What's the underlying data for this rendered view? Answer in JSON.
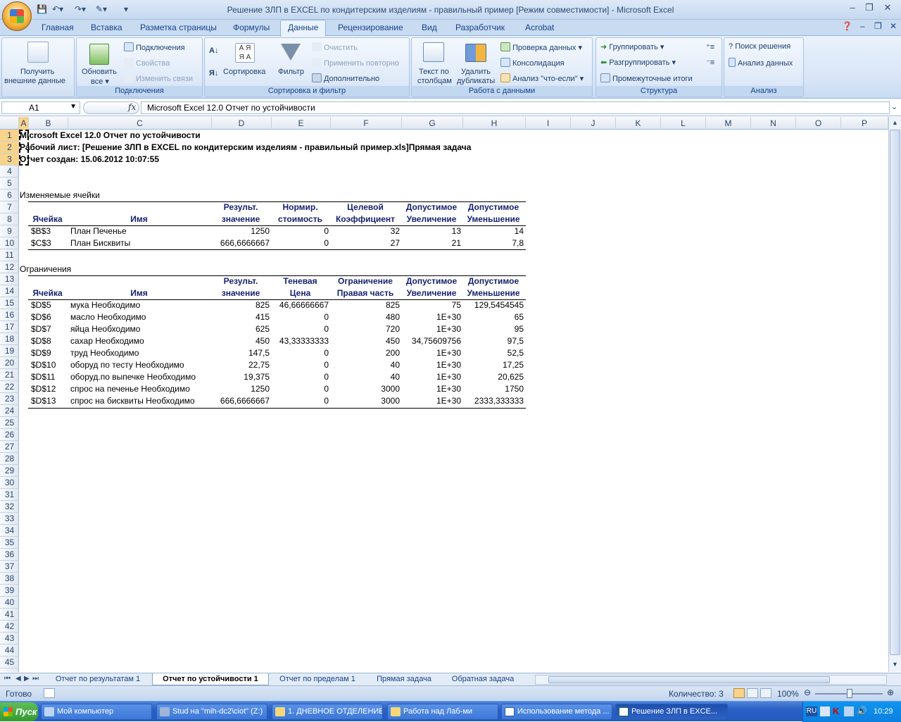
{
  "window": {
    "title": "Решение ЗЛП в EXCEL по кондитерским изделиям - правильный пример  [Режим совместимости] - Microsoft Excel"
  },
  "ribbon_tabs": [
    "Главная",
    "Вставка",
    "Разметка страницы",
    "Формулы",
    "Данные",
    "Рецензирование",
    "Вид",
    "Разработчик",
    "Acrobat"
  ],
  "ribbon": {
    "get_external_1": "Получить",
    "get_external_2": "внешние данные",
    "refresh_1": "Обновить",
    "refresh_2": "все",
    "connections": "Подключения",
    "properties": "Свойства",
    "edit_links": "Изменить связи",
    "group_connections": "Подключения",
    "sort": "Сортировка",
    "filter": "Фильтр",
    "clear": "Очистить",
    "reapply": "Применить повторно",
    "advanced": "Дополнительно",
    "group_sort": "Сортировка и фильтр",
    "text_to_cols_1": "Текст по",
    "text_to_cols_2": "столбцам",
    "remove_dup_1": "Удалить",
    "remove_dup_2": "дубликаты",
    "validation": "Проверка данных",
    "consolidate": "Консолидация",
    "whatif": "Анализ \"что-если\"",
    "group_data": "Работа с данными",
    "group_btn": "Группировать",
    "ungroup_btn": "Разгруппировать",
    "subtotals": "Промежуточные итоги",
    "group_outline": "Структура",
    "solver": "Поиск решения",
    "analysis": "Анализ данных",
    "group_analysis": "Анализ"
  },
  "formula_bar": {
    "name_box": "A1",
    "fx": "fx",
    "formula": "Microsoft Excel 12.0 Отчет по устойчивости"
  },
  "columns": [
    "A",
    "B",
    "C",
    "D",
    "E",
    "F",
    "G",
    "H",
    "I",
    "J",
    "K",
    "L",
    "M",
    "N",
    "O",
    "P"
  ],
  "report": {
    "title": "Microsoft Excel 12.0 Отчет по устойчивости",
    "worksheet": "Рабочий лист: [Решение ЗЛП в EXCEL по кондитерским изделиям - правильный пример.xls]Прямая задача",
    "created": "Отчет создан: 15.06.2012 10:07:55",
    "variable_cells": {
      "section": "Изменяемые ячейки",
      "hdr1": [
        "",
        "",
        "Результ.",
        "Нормир.",
        "Целевой",
        "Допустимое",
        "Допустимое"
      ],
      "hdr2": [
        "Ячейка",
        "Имя",
        "значение",
        "стоимость",
        "Коэффициент",
        "Увеличение",
        "Уменьшение"
      ],
      "rows": [
        [
          "$B$3",
          "План Печенье",
          "1250",
          "0",
          "32",
          "13",
          "14"
        ],
        [
          "$C$3",
          "План Бисквиты",
          "666,6666667",
          "0",
          "27",
          "21",
          "7,8"
        ]
      ]
    },
    "constraints": {
      "section": "Ограничения",
      "hdr1": [
        "",
        "",
        "Результ.",
        "Теневая",
        "Ограничение",
        "Допустимое",
        "Допустимое"
      ],
      "hdr2": [
        "Ячейка",
        "Имя",
        "значение",
        "Цена",
        "Правая часть",
        "Увеличение",
        "Уменьшение"
      ],
      "rows": [
        [
          "$D$5",
          "мука Необходимо",
          "825",
          "46,66666667",
          "825",
          "75",
          "129,5454545"
        ],
        [
          "$D$6",
          "масло  Необходимо",
          "415",
          "0",
          "480",
          "1E+30",
          "65"
        ],
        [
          "$D$7",
          "яйца Необходимо",
          "625",
          "0",
          "720",
          "1E+30",
          "95"
        ],
        [
          "$D$8",
          "сахар Необходимо",
          "450",
          "43,33333333",
          "450",
          "34,75609756",
          "97,5"
        ],
        [
          "$D$9",
          "труд Необходимо",
          "147,5",
          "0",
          "200",
          "1E+30",
          "52,5"
        ],
        [
          "$D$10",
          "оборуд по тесту Необходимо",
          "22,75",
          "0",
          "40",
          "1E+30",
          "17,25"
        ],
        [
          "$D$11",
          "оборуд.по выпечке Необходимо",
          "19,375",
          "0",
          "40",
          "1E+30",
          "20,625"
        ],
        [
          "$D$12",
          "спрос на печенье Необходимо",
          "1250",
          "0",
          "3000",
          "1E+30",
          "1750"
        ],
        [
          "$D$13",
          "спрос на бисквиты Необходимо",
          "666,6666667",
          "0",
          "3000",
          "1E+30",
          "2333,333333"
        ]
      ]
    }
  },
  "sheet_tabs": [
    "Отчет по результатам 1",
    "Отчет по устойчивости 1",
    "Отчет по пределам 1",
    "Прямая задача",
    "Обратная задача"
  ],
  "active_sheet": "Отчет по устойчивости 1",
  "status": {
    "ready": "Готово",
    "count": "Количество: 3",
    "zoom": "100%"
  },
  "taskbar": {
    "start": "Пуск",
    "items": [
      "Мой компьютер",
      "Stud на \"mih-dc2\\ciot\" (Z:)",
      "1. ДНЕВНОЕ ОТДЕЛЕНИЕ",
      "Работа над Лаб-ми",
      "Использование метода ...",
      "Решение ЗЛП в EXCE..."
    ],
    "lang": "RU",
    "clock": "10:29"
  }
}
